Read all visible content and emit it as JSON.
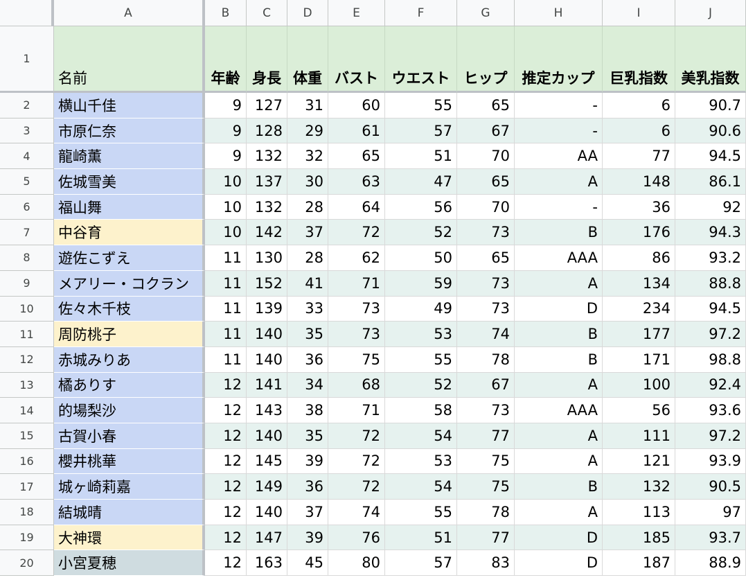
{
  "columns": [
    "A",
    "B",
    "C",
    "D",
    "E",
    "F",
    "G",
    "H",
    "I",
    "J"
  ],
  "row_numbers": [
    "1",
    "2",
    "3",
    "4",
    "5",
    "6",
    "7",
    "8",
    "9",
    "10",
    "11",
    "12",
    "13",
    "14",
    "15",
    "16",
    "17",
    "18",
    "19",
    "20"
  ],
  "headers": [
    "名前",
    "年齢",
    "身長",
    "体重",
    "バスト",
    "ウエスト",
    "ヒップ",
    "推定カップ",
    "巨乳指数",
    "美乳指数"
  ],
  "name_colors": {
    "blue": "#c9d7f5",
    "yellow": "#fdf2cc",
    "gray": "#cfdce0"
  },
  "stripe_colors": {
    "white": "#ffffff",
    "green": "#e6f2ef"
  },
  "rows": [
    {
      "name": "横山千佳",
      "name_color": "blue",
      "cells": [
        "9",
        "127",
        "31",
        "60",
        "55",
        "65",
        "-",
        "6",
        "90.7"
      ]
    },
    {
      "name": "市原仁奈",
      "name_color": "blue",
      "cells": [
        "9",
        "128",
        "29",
        "61",
        "57",
        "67",
        "-",
        "6",
        "90.6"
      ]
    },
    {
      "name": "龍崎薫",
      "name_color": "blue",
      "cells": [
        "9",
        "132",
        "32",
        "65",
        "51",
        "70",
        "AA",
        "77",
        "94.5"
      ]
    },
    {
      "name": "佐城雪美",
      "name_color": "blue",
      "cells": [
        "10",
        "137",
        "30",
        "63",
        "47",
        "65",
        "A",
        "148",
        "86.1"
      ]
    },
    {
      "name": "福山舞",
      "name_color": "blue",
      "cells": [
        "10",
        "132",
        "28",
        "64",
        "56",
        "70",
        "-",
        "36",
        "92"
      ]
    },
    {
      "name": "中谷育",
      "name_color": "yellow",
      "cells": [
        "10",
        "142",
        "37",
        "72",
        "52",
        "73",
        "B",
        "176",
        "94.3"
      ]
    },
    {
      "name": "遊佐こずえ",
      "name_color": "blue",
      "cells": [
        "11",
        "130",
        "28",
        "62",
        "50",
        "65",
        "AAA",
        "86",
        "93.2"
      ]
    },
    {
      "name": "メアリー・コクラン",
      "name_color": "blue",
      "cells": [
        "11",
        "152",
        "41",
        "71",
        "59",
        "73",
        "A",
        "134",
        "88.8"
      ]
    },
    {
      "name": "佐々木千枝",
      "name_color": "blue",
      "cells": [
        "11",
        "139",
        "33",
        "73",
        "49",
        "73",
        "D",
        "234",
        "94.5"
      ]
    },
    {
      "name": "周防桃子",
      "name_color": "yellow",
      "cells": [
        "11",
        "140",
        "35",
        "73",
        "53",
        "74",
        "B",
        "177",
        "97.2"
      ]
    },
    {
      "name": "赤城みりあ",
      "name_color": "blue",
      "cells": [
        "11",
        "140",
        "36",
        "75",
        "55",
        "78",
        "B",
        "171",
        "98.8"
      ]
    },
    {
      "name": "橘ありす",
      "name_color": "blue",
      "cells": [
        "12",
        "141",
        "34",
        "68",
        "52",
        "67",
        "A",
        "100",
        "92.4"
      ]
    },
    {
      "name": "的場梨沙",
      "name_color": "blue",
      "cells": [
        "12",
        "143",
        "38",
        "71",
        "58",
        "73",
        "AAA",
        "56",
        "93.6"
      ]
    },
    {
      "name": "古賀小春",
      "name_color": "blue",
      "cells": [
        "12",
        "140",
        "35",
        "72",
        "54",
        "77",
        "A",
        "111",
        "97.2"
      ]
    },
    {
      "name": "櫻井桃華",
      "name_color": "blue",
      "cells": [
        "12",
        "145",
        "39",
        "72",
        "53",
        "75",
        "A",
        "121",
        "93.9"
      ]
    },
    {
      "name": "城ヶ崎莉嘉",
      "name_color": "blue",
      "cells": [
        "12",
        "149",
        "36",
        "72",
        "54",
        "75",
        "B",
        "132",
        "90.5"
      ]
    },
    {
      "name": "結城晴",
      "name_color": "blue",
      "cells": [
        "12",
        "140",
        "37",
        "74",
        "55",
        "78",
        "A",
        "113",
        "97"
      ]
    },
    {
      "name": "大神環",
      "name_color": "yellow",
      "cells": [
        "12",
        "147",
        "39",
        "76",
        "51",
        "77",
        "D",
        "185",
        "93.7"
      ]
    },
    {
      "name": "小宮夏穂",
      "name_color": "gray",
      "cells": [
        "12",
        "163",
        "45",
        "80",
        "57",
        "83",
        "D",
        "187",
        "88.9"
      ]
    }
  ]
}
